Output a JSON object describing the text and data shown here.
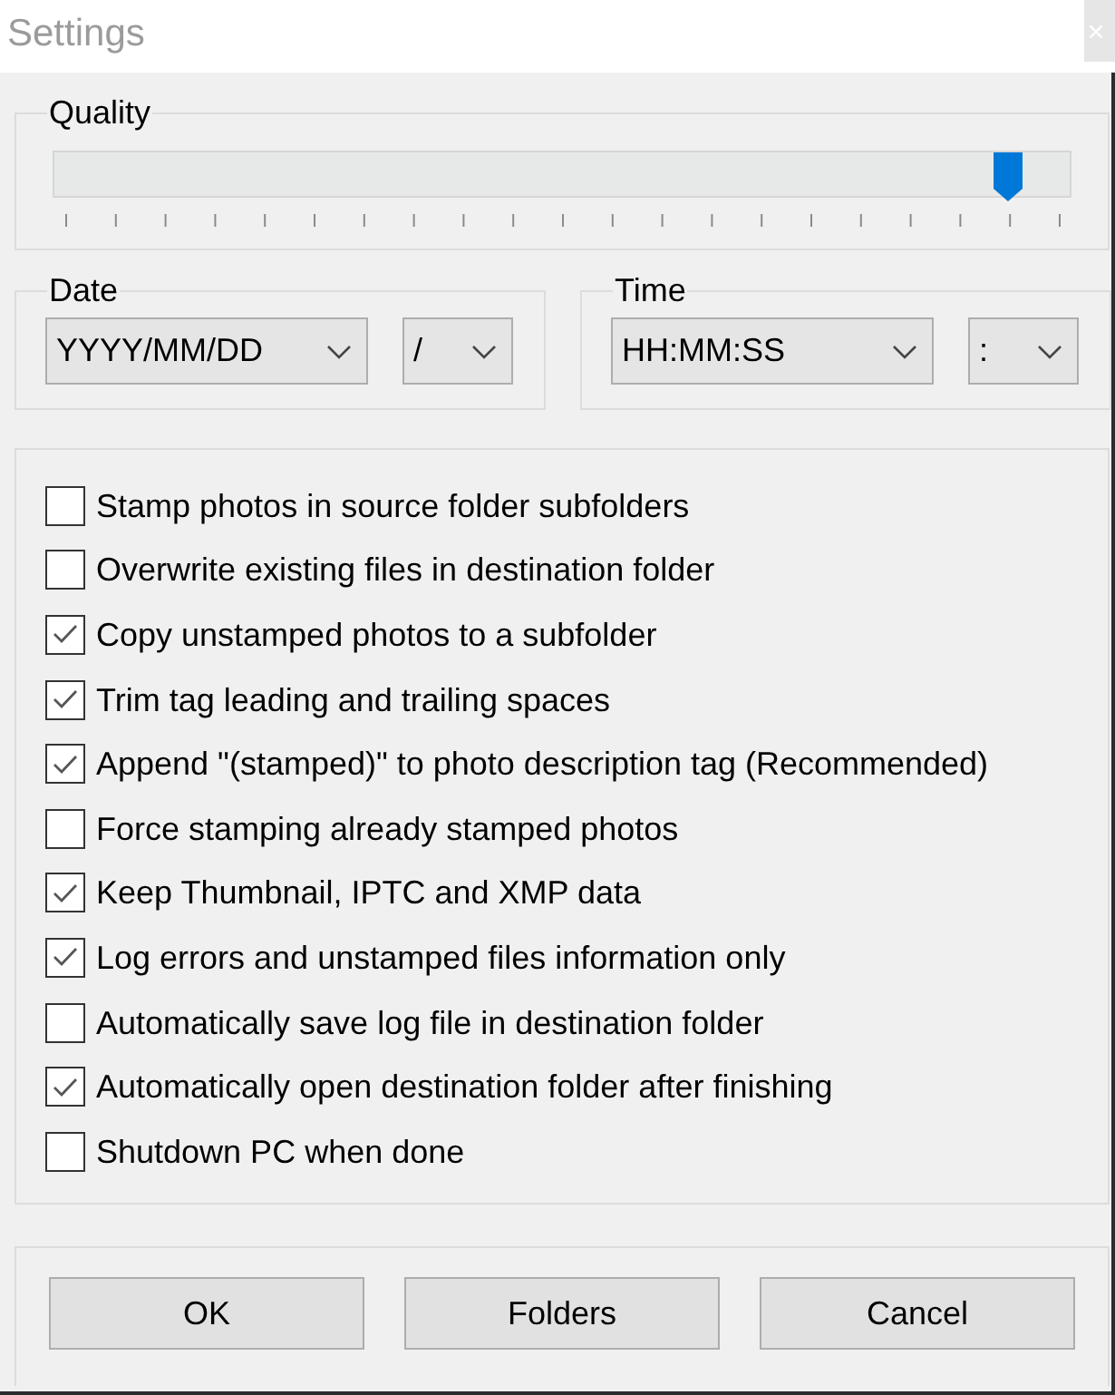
{
  "window": {
    "title": "Settings"
  },
  "quality": {
    "label": "Quality",
    "level": 0.94
  },
  "date": {
    "label": "Date",
    "format": "YYYY/MM/DD",
    "separator": "/"
  },
  "time": {
    "label": "Time",
    "format": "HH:MM:SS",
    "separator": ":"
  },
  "options": [
    {
      "label": "Stamp photos in source folder subfolders",
      "checked": false
    },
    {
      "label": "Overwrite existing files in destination folder",
      "checked": false
    },
    {
      "label": "Copy unstamped photos to a subfolder",
      "checked": true
    },
    {
      "label": "Trim tag leading and trailing spaces",
      "checked": true
    },
    {
      "label": "Append \"(stamped)\" to photo description tag (Recommended)",
      "checked": true
    },
    {
      "label": "Force stamping already stamped photos",
      "checked": false
    },
    {
      "label": "Keep Thumbnail, IPTC and XMP data",
      "checked": true
    },
    {
      "label": "Log errors and unstamped files information only",
      "checked": true
    },
    {
      "label": "Automatically save log file in destination folder",
      "checked": false
    },
    {
      "label": "Automatically open destination folder after finishing",
      "checked": true
    },
    {
      "label": "Shutdown PC when done",
      "checked": false
    }
  ],
  "buttons": [
    {
      "label": "OK"
    },
    {
      "label": "Folders"
    },
    {
      "label": "Cancel"
    }
  ]
}
